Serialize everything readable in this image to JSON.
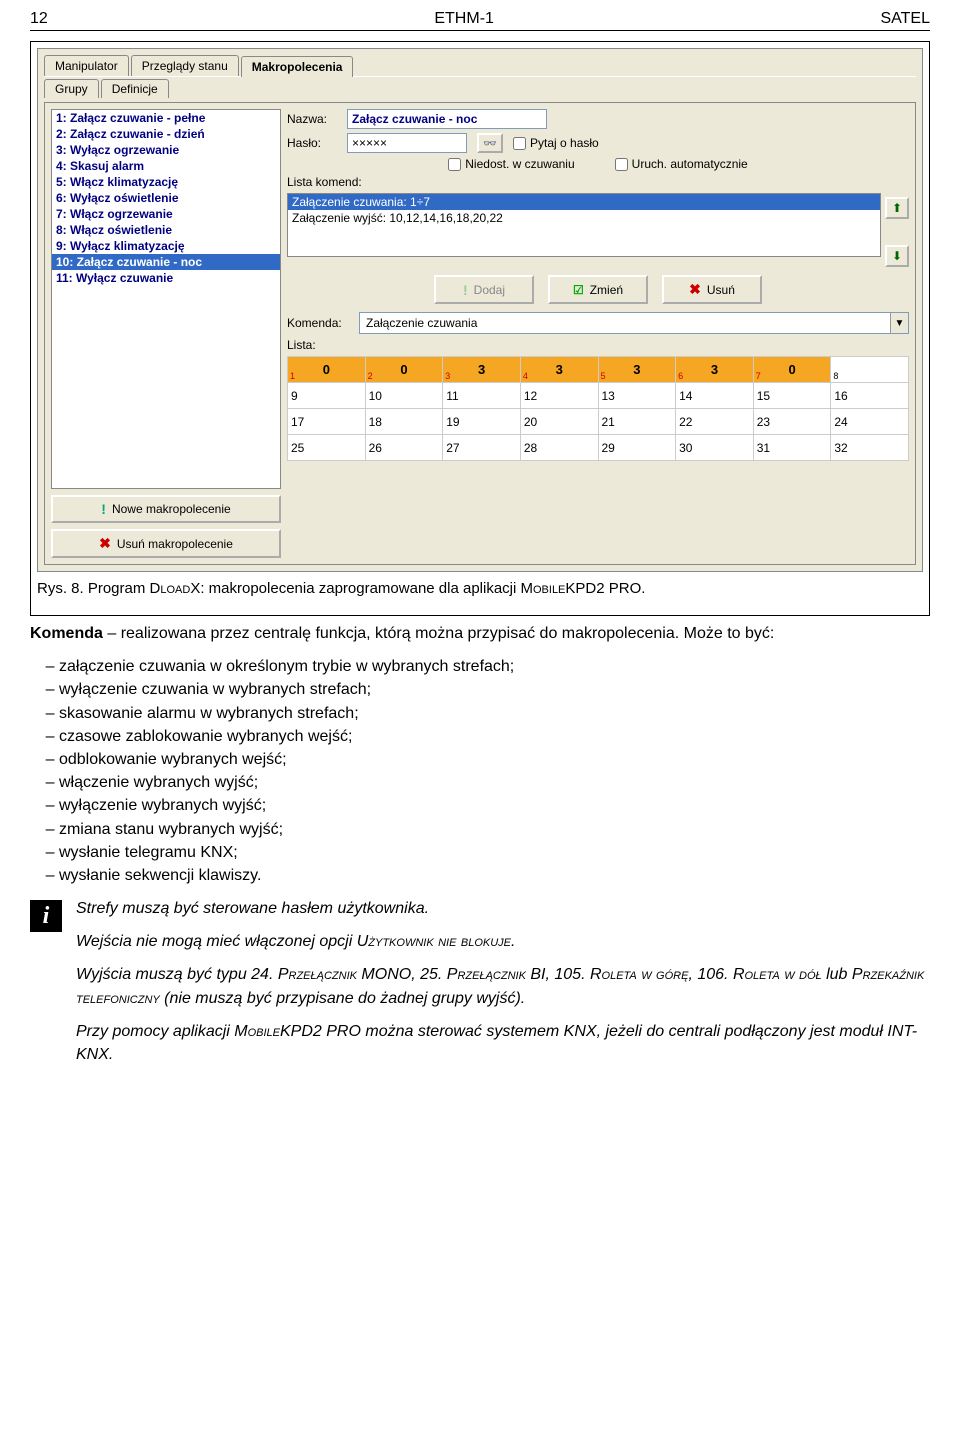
{
  "header": {
    "left": "12",
    "center": "ETHM-1",
    "right": "SATEL"
  },
  "tabs": {
    "t1": "Manipulator",
    "t2": "Przeglądy stanu",
    "t3": "Makropolecenia"
  },
  "subtabs": {
    "s1": "Grupy",
    "s2": "Definicje"
  },
  "macro_list": [
    "1: Załącz czuwanie - pełne",
    "2: Załącz czuwanie - dzień",
    "3: Wyłącz ogrzewanie",
    "4: Skasuj alarm",
    "5: Włącz klimatyzację",
    "6: Wyłącz oświetlenie",
    "7: Włącz ogrzewanie",
    "8: Włącz oświetlenie",
    "9: Wyłącz klimatyzację",
    "10: Załącz czuwanie - noc",
    "11: Wyłącz czuwanie"
  ],
  "macro_selected_index": 9,
  "left_buttons": {
    "new": "Nowe makropolecenie",
    "del": "Usuń makropolecenie"
  },
  "form": {
    "nazwa_label": "Nazwa:",
    "nazwa_value": "Załącz czuwanie - noc",
    "haslo_label": "Hasło:",
    "haslo_value": "×××××",
    "pytaj": "Pytaj o hasło",
    "niedost": "Niedost. w czuwaniu",
    "uruch": "Uruch. automatycznie",
    "lista_komend": "Lista komend:",
    "komenda_label": "Komenda:",
    "komenda_value": "Załączenie czuwania",
    "lista_label": "Lista:"
  },
  "cmd_list": [
    "Załączenie czuwania: 1÷7",
    "Załączenie wyjść: 10,12,14,16,18,20,22"
  ],
  "cmd_selected_index": 0,
  "action_buttons": {
    "add": "Dodaj",
    "change": "Zmień",
    "del": "Usuń"
  },
  "grid": {
    "row1": [
      {
        "n": "1",
        "v": "0"
      },
      {
        "n": "2",
        "v": "0"
      },
      {
        "n": "3",
        "v": "3"
      },
      {
        "n": "4",
        "v": "3"
      },
      {
        "n": "5",
        "v": "3"
      },
      {
        "n": "6",
        "v": "3"
      },
      {
        "n": "7",
        "v": "0"
      },
      {
        "n": "8",
        "v": ""
      }
    ],
    "rows": [
      [
        "9",
        "10",
        "11",
        "12",
        "13",
        "14",
        "15",
        "16"
      ],
      [
        "17",
        "18",
        "19",
        "20",
        "21",
        "22",
        "23",
        "24"
      ],
      [
        "25",
        "26",
        "27",
        "28",
        "29",
        "30",
        "31",
        "32"
      ]
    ]
  },
  "caption": {
    "prefix": "Rys. 8. Program ",
    "app1": "DloadX",
    "mid": ": makropolecenia zaprogramowane dla aplikacji ",
    "app2": "MobileKPD2 PRO",
    "suffix": "."
  },
  "body": {
    "defn_term": "Komenda",
    "defn_rest": " – realizowana przez centralę funkcja, którą można przypisać do makropolecenia. Może to być:",
    "bullets": [
      "załączenie czuwania w określonym trybie w wybranych strefach;",
      "wyłączenie czuwania w wybranych strefach;",
      "skasowanie alarmu w wybranych strefach;",
      "czasowe zablokowanie wybranych wejść;",
      "odblokowanie wybranych wejść;",
      "włączenie wybranych wyjść;",
      "wyłączenie wybranych wyjść;",
      "zmiana stanu wybranych wyjść;",
      "wysłanie telegramu KNX;",
      "wysłanie sekwencji klawiszy."
    ]
  },
  "notes": {
    "n1": "Strefy muszą być sterowane hasłem użytkownika.",
    "n2_a": "Wejścia nie mogą mieć włączonej opcji ",
    "n2_sc": "Użytkownik nie blokuje",
    "n2_b": ".",
    "n3_a": "Wyjścia muszą być typu 24. ",
    "n3_sc1": "Przełącznik MONO",
    "n3_b": ", 25. ",
    "n3_sc2": "Przełącznik BI",
    "n3_c": ", 105. ",
    "n3_sc3": "Roleta w górę",
    "n3_d": ", 106. ",
    "n3_sc4": "Roleta w dół",
    "n3_e": " lub ",
    "n3_sc5": "Przekaźnik telefoniczny",
    "n3_f": " (nie muszą być przypisane do żadnej grupy wyjść).",
    "n4_a": "Przy pomocy aplikacji ",
    "n4_sc": "MobileKPD2 PRO",
    "n4_b": " można sterować systemem KNX, jeżeli do centrali podłączony jest moduł INT-KNX."
  }
}
